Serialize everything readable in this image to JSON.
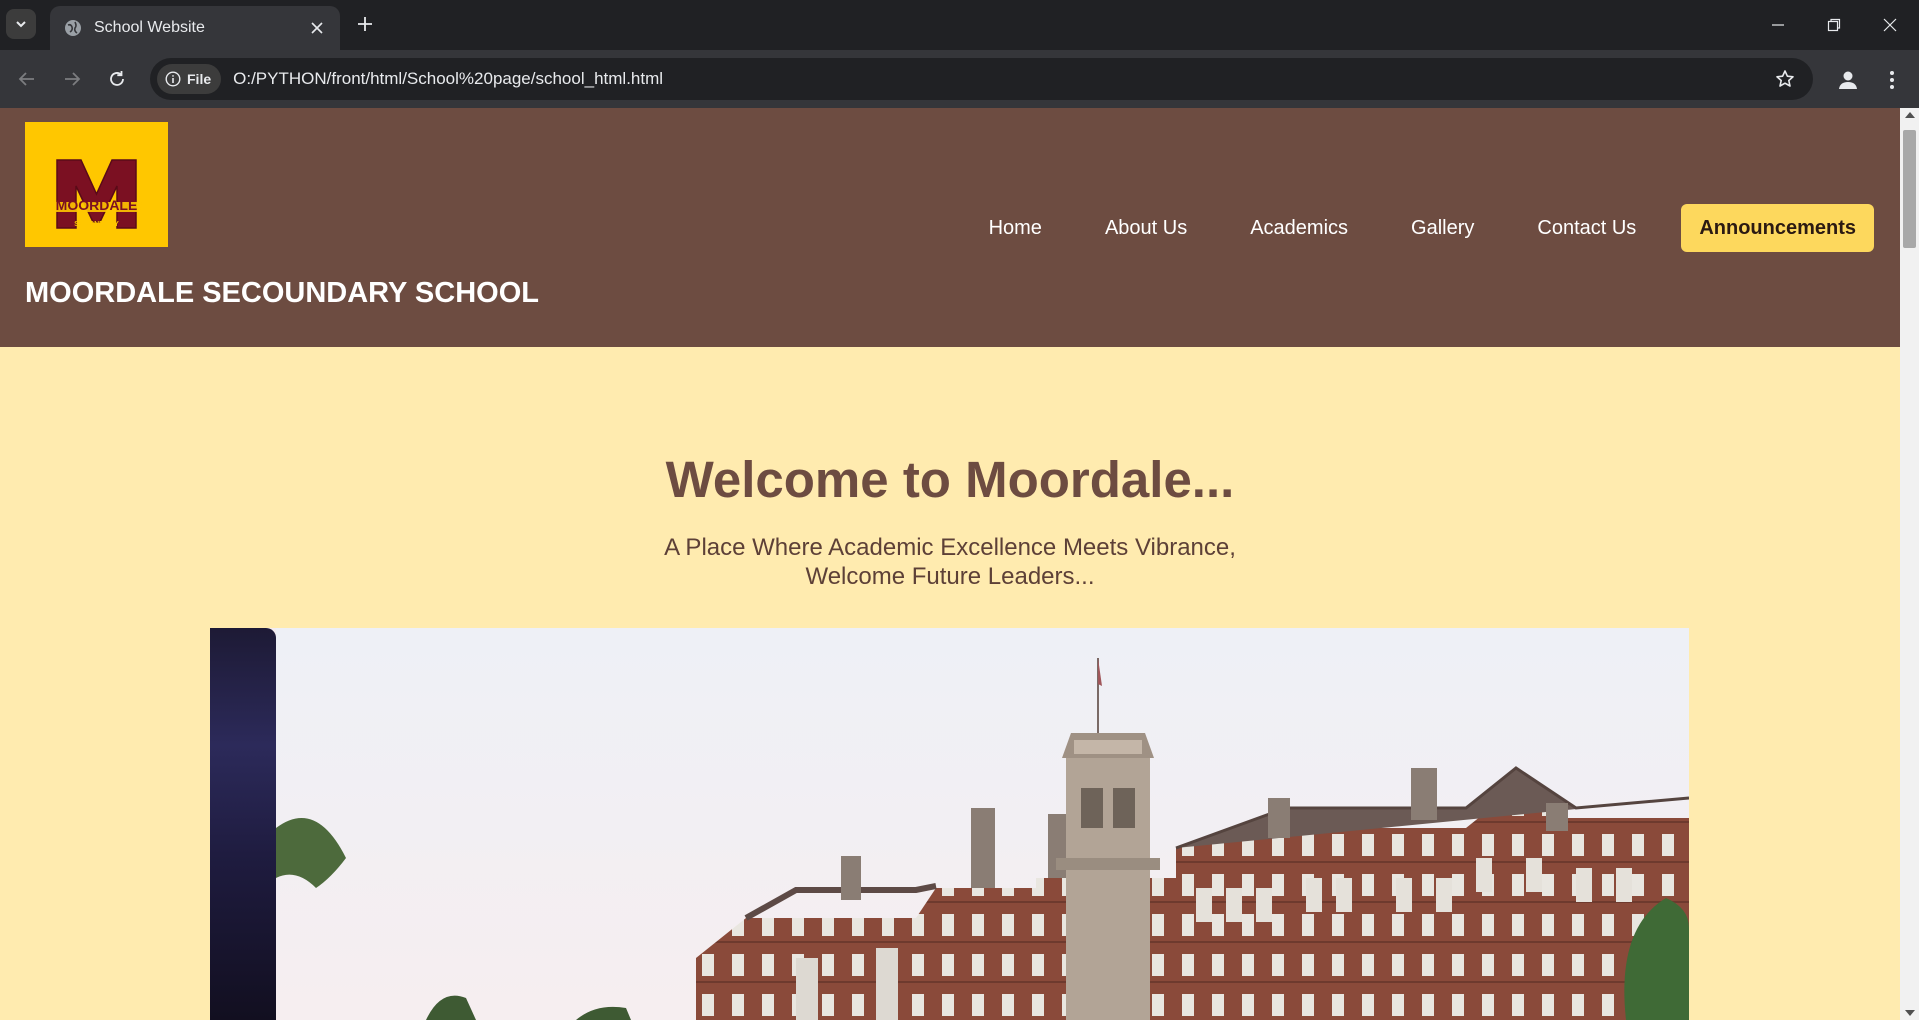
{
  "browser": {
    "tab_title": "School Website",
    "url_chip": "File",
    "url": "O:/PYTHON/front/html/School%20page/school_html.html",
    "icons": [
      "tab-list-icon",
      "globe-icon",
      "close-icon",
      "plus-icon",
      "minimize-icon",
      "restore-icon",
      "window-close-icon",
      "back-icon",
      "forward-icon",
      "reload-icon",
      "info-icon",
      "star-icon",
      "profile-icon",
      "menu-icon"
    ]
  },
  "site": {
    "school_name": "MOORDALE SECOUNDARY SCHOOL",
    "logo": {
      "letter": "M",
      "text": "MOORDALE",
      "subtext": "SECONDARY"
    },
    "nav": [
      {
        "label": "Home"
      },
      {
        "label": "About Us"
      },
      {
        "label": "Academics"
      },
      {
        "label": "Gallery"
      },
      {
        "label": "Contact Us"
      }
    ],
    "announcements_label": "Announcements",
    "colors": {
      "header": "#6d4c41",
      "page_bg": "#ffebaf",
      "accent": "#fdd85d",
      "logo_bg": "#ffc700",
      "logo_maroon": "#7b1022"
    }
  },
  "hero": {
    "title": "Welcome to Moordale...",
    "subtitle_line1": "A Place Where Academic Excellence Meets Vibrance,",
    "subtitle_line2": "Welcome Future Leaders..."
  }
}
